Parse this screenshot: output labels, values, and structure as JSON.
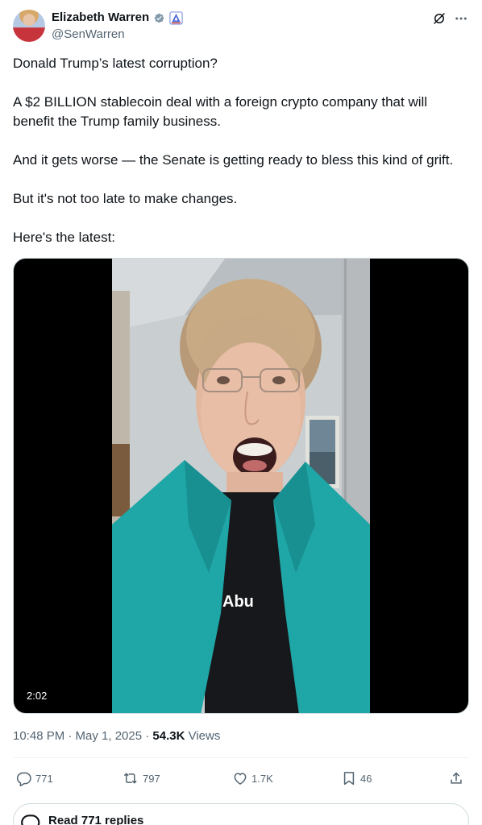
{
  "author": {
    "display_name": "Elizabeth Warren",
    "handle": "@SenWarren"
  },
  "icons": {
    "verified": "verified-badge-icon",
    "affiliate": "government-affiliate-icon",
    "grok": "grok-icon",
    "more": "more-options-icon"
  },
  "tweet": {
    "paragraphs": [
      "Donald Trump’s latest corruption?",
      "A $2 BILLION stablecoin deal with a foreign crypto company that will benefit the Trump family business.",
      "And it gets worse — the Senate is getting ready to bless this kind of grift.",
      "But it's not too late to make changes.",
      "Here's the latest:"
    ]
  },
  "media": {
    "duration": "2:02",
    "caption": "Abu"
  },
  "meta": {
    "timestamp": "10:48 PM · May 1, 2025 · ",
    "views_count": "54.3K",
    "views_label": " Views"
  },
  "actions": {
    "replies": "771",
    "reposts": "797",
    "likes": "1.7K",
    "bookmarks": "46"
  },
  "read_replies": {
    "label": "Read 771 replies"
  },
  "colors": {
    "text_primary": "#0f1419",
    "text_secondary": "#536471",
    "verified_blue": "#829aab",
    "border": "#cfd9de"
  }
}
